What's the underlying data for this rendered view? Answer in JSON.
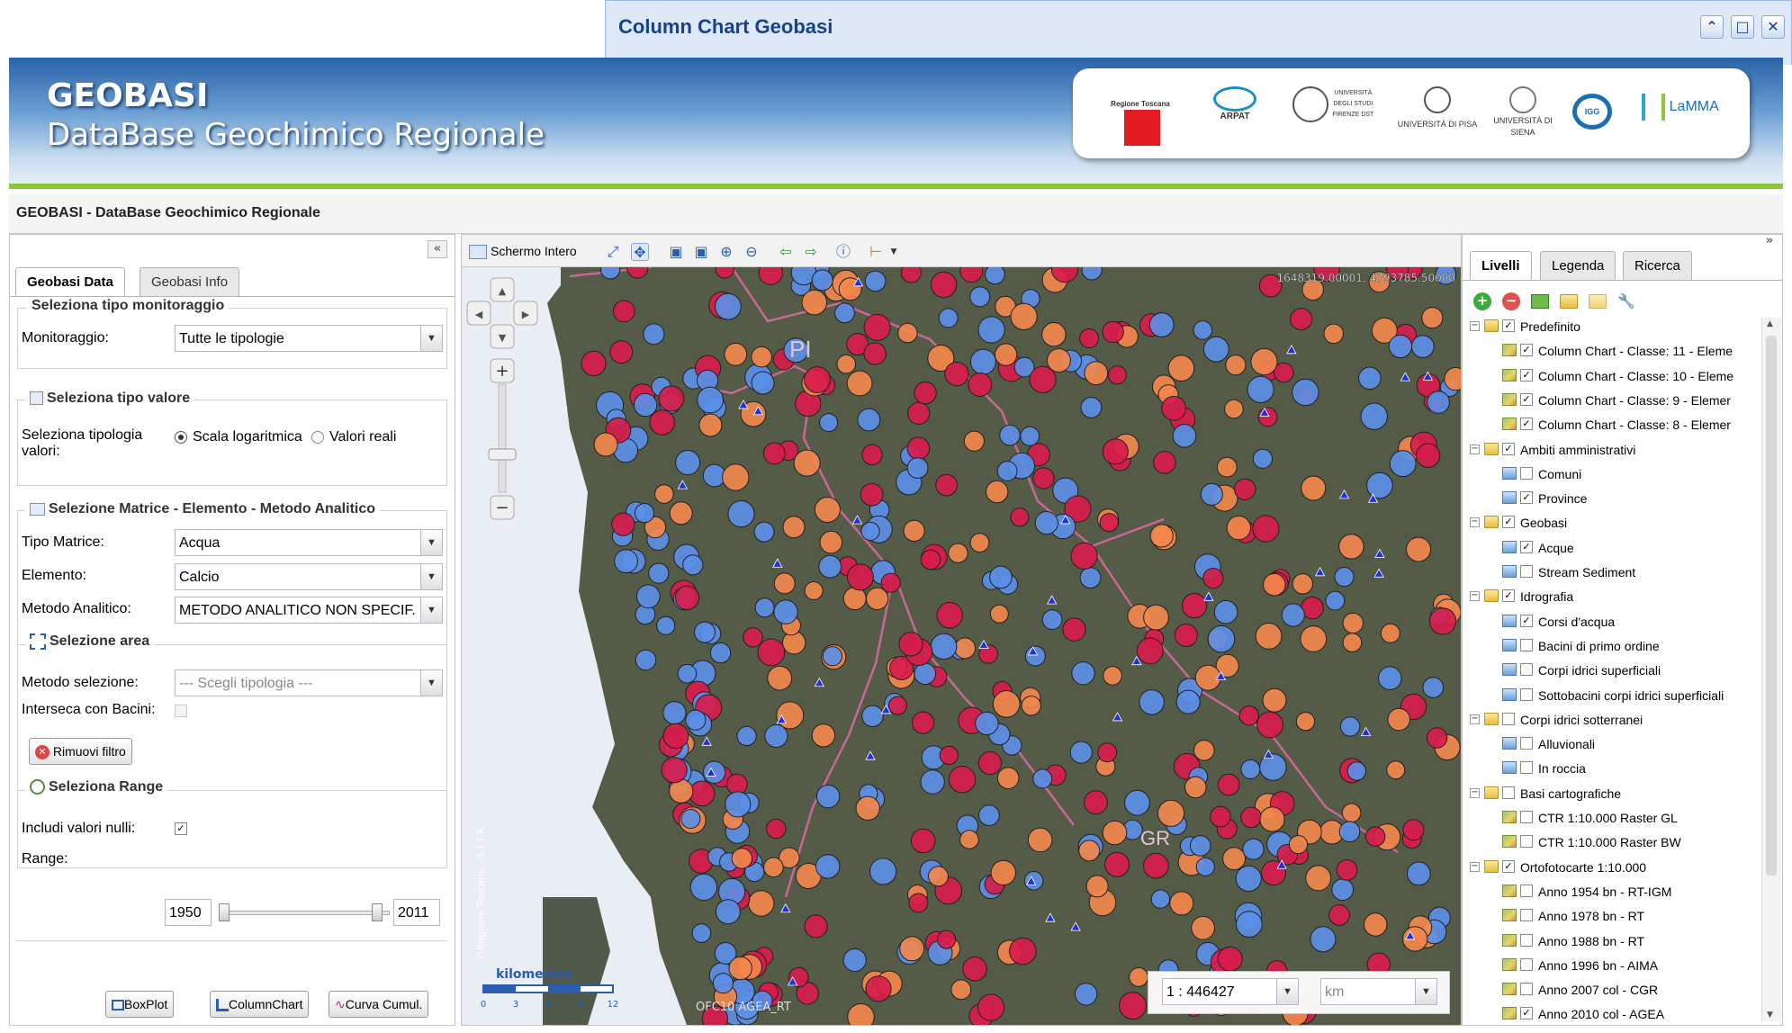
{
  "popup": {
    "title": "Column Chart Geobasi",
    "btn_restore": "⌃",
    "btn_max": "□",
    "btn_close": "✕"
  },
  "header": {
    "title": "GEOBASI",
    "subtitle": "DataBase Geochimico Regionale",
    "logos": [
      "Regione Toscana",
      "ARPAT",
      "UNIVERSITÀ DEGLI STUDI FIRENZE DST",
      "UNIVERSITÀ DI PISA",
      "UNIVERSITÀ DI SIENA",
      "IGG",
      "LaMMA"
    ]
  },
  "app": {
    "title": "GEOBASI - DataBase Geochimico Regionale"
  },
  "left": {
    "collapse": "«",
    "tabs": [
      "Geobasi Data",
      "Geobasi Info"
    ],
    "monitoraggio": {
      "legend": "Seleziona tipo monitoraggio",
      "label": "Monitoraggio:",
      "value": "Tutte le tipologie"
    },
    "valore": {
      "legend": "Seleziona tipo valore",
      "label": "Seleziona tipologia valori:",
      "opt1": "Scala logaritmica",
      "opt2": "Valori reali"
    },
    "matrice": {
      "legend": "Selezione Matrice - Elemento - Metodo Analitico",
      "tipo_label": "Tipo Matrice:",
      "tipo_value": "Acqua",
      "elem_label": "Elemento:",
      "elem_value": "Calcio",
      "metodo_label": "Metodo Analitico:",
      "metodo_value": "METODO ANALITICO NON SPECIF."
    },
    "area": {
      "legend": "Selezione area",
      "metodo_label": "Metodo selezione:",
      "metodo_placeholder": "--- Scegli tipologia ---",
      "interseca_label": "Interseca con Bacini:",
      "rimuovi": "Rimuovi filtro"
    },
    "range": {
      "legend": "Seleziona Range",
      "nulli_label": "Includi valori nulli:",
      "range_label": "Range:",
      "min": "1950",
      "max": "2011"
    },
    "buttons": {
      "boxplot": "BoxPlot",
      "columnchart": "ColumnChart",
      "curva": "Curva Cumul."
    }
  },
  "map": {
    "toolbar_label": "Schermo Intero",
    "coords": "1648319.00001, 4793785.50000",
    "labels": {
      "province": "PI",
      "grosseto": "GR"
    },
    "scalebar": {
      "title": "kilometers",
      "ticks": [
        "0",
        "3",
        "6",
        "9",
        "12"
      ]
    },
    "credit_left": "©Regione Toscana - S.I.T.A.",
    "credit_bottom": "OFC10 AGEA_RT",
    "scale_value": "1 : 446427",
    "unit_value": "km"
  },
  "right": {
    "collapse": "»",
    "tabs": [
      "Livelli",
      "Legenda",
      "Ricerca"
    ],
    "tree": [
      {
        "label": "Predefinito",
        "level": 0,
        "icon": "folder",
        "checked": true
      },
      {
        "label": "Column Chart - Classe: 11 - Eleme",
        "level": 1,
        "icon": "raster",
        "checked": true
      },
      {
        "label": "Column Chart - Classe: 10 - Eleme",
        "level": 1,
        "icon": "raster",
        "checked": true
      },
      {
        "label": "Column Chart - Classe: 9 - Elemer",
        "level": 1,
        "icon": "raster",
        "checked": true
      },
      {
        "label": "Column Chart - Classe: 8 - Elemer",
        "level": 1,
        "icon": "raster",
        "checked": true
      },
      {
        "label": "Ambiti amministrativi",
        "level": 0,
        "icon": "folder",
        "checked": true
      },
      {
        "label": "Comuni",
        "level": 1,
        "icon": "layer",
        "checked": false
      },
      {
        "label": "Province",
        "level": 1,
        "icon": "layer",
        "checked": true
      },
      {
        "label": "Geobasi",
        "level": 0,
        "icon": "folder",
        "checked": true
      },
      {
        "label": "Acque",
        "level": 1,
        "icon": "layer",
        "checked": true
      },
      {
        "label": "Stream Sediment",
        "level": 1,
        "icon": "layer",
        "checked": false
      },
      {
        "label": "Idrografia",
        "level": 0,
        "icon": "folder",
        "checked": true
      },
      {
        "label": "Corsi d'acqua",
        "level": 1,
        "icon": "layer",
        "checked": true
      },
      {
        "label": "Bacini di primo ordine",
        "level": 1,
        "icon": "layer",
        "checked": false
      },
      {
        "label": "Corpi idrici superficiali",
        "level": 1,
        "icon": "layer",
        "checked": false
      },
      {
        "label": "Sottobacini corpi idrici superficiali",
        "level": 1,
        "icon": "layer",
        "checked": false
      },
      {
        "label": "Corpi idrici sotterranei",
        "level": 0,
        "icon": "folder",
        "checked": false
      },
      {
        "label": "Alluvionali",
        "level": 1,
        "icon": "layer",
        "checked": false
      },
      {
        "label": "In roccia",
        "level": 1,
        "icon": "layer",
        "checked": false
      },
      {
        "label": "Basi cartografiche",
        "level": 0,
        "icon": "folder",
        "checked": false
      },
      {
        "label": "CTR 1:10.000 Raster GL",
        "level": 1,
        "icon": "raster",
        "checked": false
      },
      {
        "label": "CTR 1:10.000 Raster BW",
        "level": 1,
        "icon": "raster",
        "checked": false
      },
      {
        "label": "Ortofotocarte 1:10.000",
        "level": 0,
        "icon": "folder",
        "checked": true
      },
      {
        "label": "Anno 1954 bn - RT-IGM",
        "level": 1,
        "icon": "raster",
        "checked": false
      },
      {
        "label": "Anno 1978 bn - RT",
        "level": 1,
        "icon": "raster",
        "checked": false
      },
      {
        "label": "Anno 1988 bn - RT",
        "level": 1,
        "icon": "raster",
        "checked": false
      },
      {
        "label": "Anno 1996 bn - AIMA",
        "level": 1,
        "icon": "raster",
        "checked": false
      },
      {
        "label": "Anno 2007 col - CGR",
        "level": 1,
        "icon": "raster",
        "checked": false
      },
      {
        "label": "Anno 2010 col - AGEA",
        "level": 1,
        "icon": "raster",
        "checked": true
      }
    ]
  },
  "colors": {
    "red": "#d81b4a",
    "orange": "#f4874b",
    "blue": "#5b8fe8",
    "accent": "#15428b",
    "green": "#8cc63e"
  }
}
